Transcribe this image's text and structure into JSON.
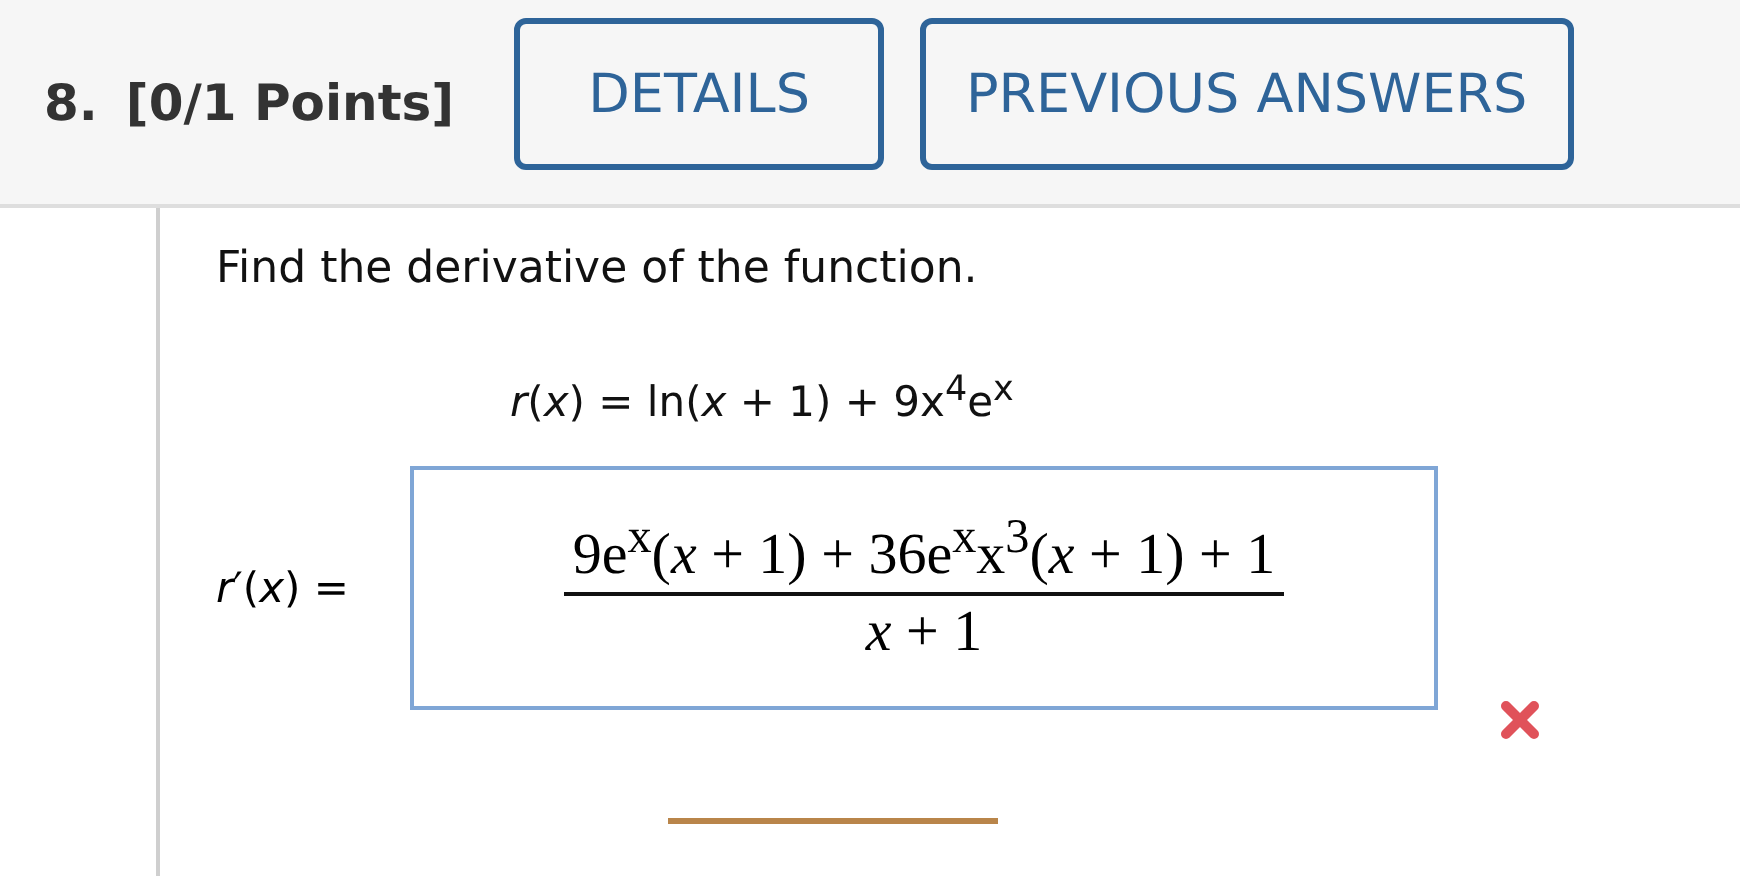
{
  "question": {
    "number": "8.",
    "points": "[0/1 Points]"
  },
  "buttons": [
    {
      "label": "DETAILS"
    },
    {
      "label": "PREVIOUS ANSWERS"
    }
  ],
  "prompt": "Find the derivative of the function.",
  "function": "*r*(*x*) = ln(*x* + 1) + 9x$^{4}$e$^{x}$",
  "answer": {
    "label": "*r*′(*x*) =",
    "numerator": "9e$^{x}$(*x* + 1) + 36e$^{x}$x$^{3}$(*x* + 1) + 1",
    "denominator": "*x* + 1",
    "correct": false
  }
}
